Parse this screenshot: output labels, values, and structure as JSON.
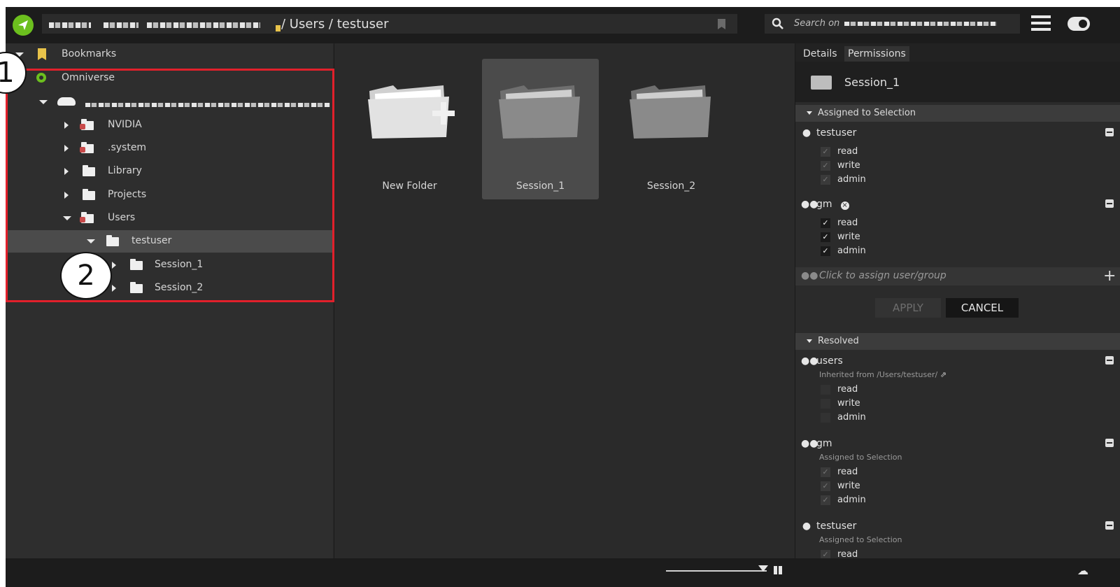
{
  "topbar": {
    "path": "/ Users / testuser",
    "search_placeholder": "Search on"
  },
  "tree": {
    "bookmarks": "Bookmarks",
    "omniverse": "Omniverse",
    "items": [
      {
        "label": "NVIDIA"
      },
      {
        "label": ".system"
      },
      {
        "label": "Library"
      },
      {
        "label": "Projects"
      },
      {
        "label": "Users"
      },
      {
        "label": "testuser"
      },
      {
        "label": "Session_1"
      },
      {
        "label": "Session_2"
      }
    ]
  },
  "callouts": {
    "one": "1",
    "two": "2"
  },
  "content": {
    "tiles": [
      {
        "name": "New Folder"
      },
      {
        "name": "Session_1"
      },
      {
        "name": "Session_2"
      }
    ]
  },
  "panel": {
    "tabs": [
      "Details",
      "Permissions"
    ],
    "selection_name": "Session_1",
    "assigned_header": "Assigned to Selection",
    "assigned": [
      {
        "name": "testuser",
        "perms": [
          "read",
          "write",
          "admin"
        ]
      },
      {
        "name": "gm",
        "perms": [
          "read",
          "write",
          "admin"
        ]
      }
    ],
    "assign_placeholder": "Click to assign user/group",
    "apply": "APPLY",
    "cancel": "CANCEL",
    "resolved_header": "Resolved",
    "resolved": [
      {
        "name": "users",
        "source": "Inherited from /Users/testuser/",
        "perms": [
          "read",
          "write",
          "admin"
        ]
      },
      {
        "name": "gm",
        "source": "Assigned to Selection",
        "perms": [
          "read",
          "write",
          "admin"
        ]
      },
      {
        "name": "testuser",
        "source": "Assigned to Selection",
        "perms": [
          "read"
        ]
      }
    ]
  },
  "colors": {
    "accent_green": "#6cbf1e",
    "highlight_red": "#e1202b"
  }
}
